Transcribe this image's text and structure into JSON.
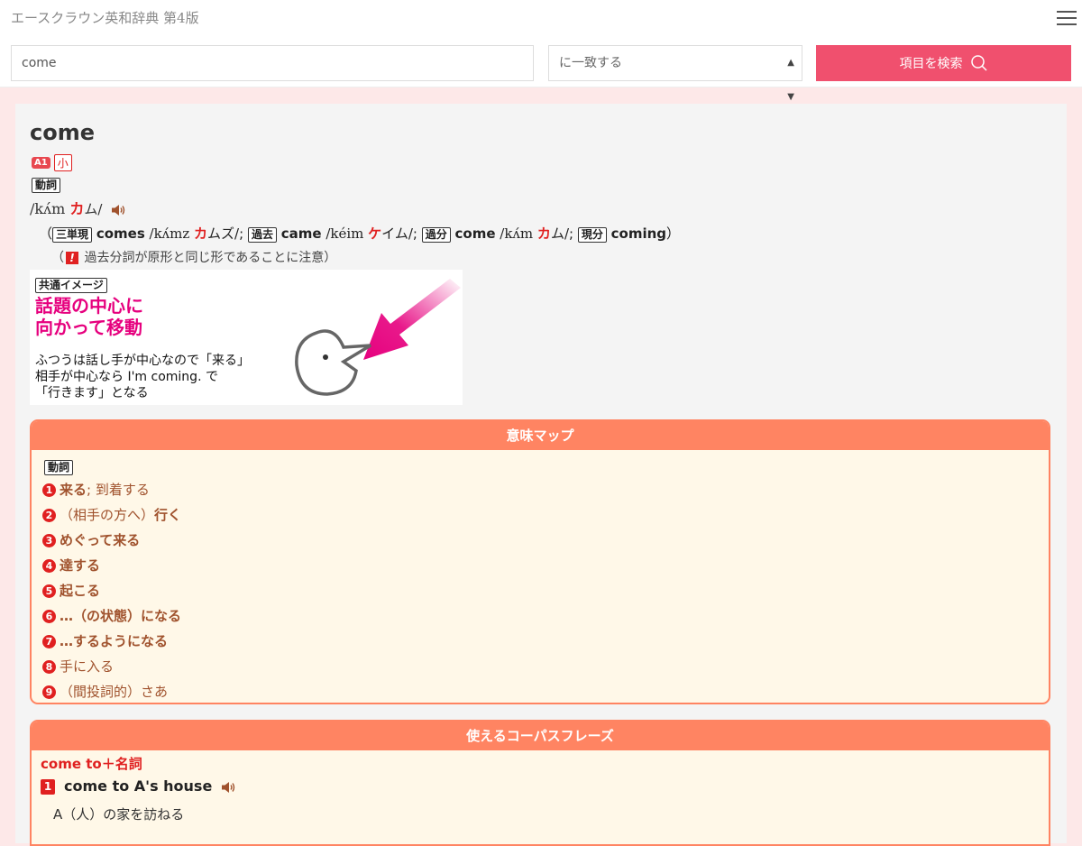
{
  "app": {
    "title": "エースクラウン英和辞典 第4版"
  },
  "search": {
    "query": "come",
    "match_mode": "に一致する",
    "button_label": "項目を検索"
  },
  "entry": {
    "headword": "come",
    "level_badge": "A1",
    "level_badge2": "小",
    "pos": "動詞",
    "pron_ipa": "/kʌ́m ",
    "pron_kana_red": "カ",
    "pron_kana_rest": "ム/",
    "inflections": {
      "open": "（",
      "t1": "三単現",
      "w1": "comes",
      "i1": " /kʌ́mz ",
      "r1": "カ",
      "k1": "ムズ/; ",
      "t2": "過去",
      "w2": "came",
      "i2": " /kéim ",
      "r2": "ケ",
      "k2": "イム/; ",
      "t3": "過分",
      "w3": "come",
      "i3": " /kʌ́m ",
      "r3": "カ",
      "k3": "ム/; ",
      "t4": "現分",
      "w4": "coming",
      "close": "）"
    },
    "note_open": "（",
    "note_icon": "!",
    "note_text": "過去分詞が原形と同じ形であることに注意）",
    "image": {
      "tag": "共通イメージ",
      "head1": "話題の中心に",
      "head2": "向かって移動",
      "line1": "ふつうは話し手が中心なので「来る」",
      "line2": "相手が中心なら I'm coming. で",
      "line3": "「行きます」となる"
    }
  },
  "meaning_map": {
    "title": "意味マップ",
    "pos": "動詞",
    "items": [
      {
        "num": "1",
        "bold": "来る",
        "rest": "; 到着する"
      },
      {
        "num": "2",
        "bold": "",
        "rest": "（相手の方へ）",
        "bold2": "行く"
      },
      {
        "num": "3",
        "bold": "めぐって来る",
        "rest": ""
      },
      {
        "num": "4",
        "bold": "達する",
        "rest": ""
      },
      {
        "num": "5",
        "bold": "起こる",
        "rest": ""
      },
      {
        "num": "6",
        "bold": "…（の状態）になる",
        "rest": ""
      },
      {
        "num": "7",
        "bold": "…するようになる",
        "rest": ""
      },
      {
        "num": "8",
        "bold": "",
        "rest": "手に入る"
      },
      {
        "num": "9",
        "bold": "",
        "rest": "（間投詞的）さあ"
      }
    ]
  },
  "corpus": {
    "title": "使えるコーパスフレーズ",
    "pattern": "come to＋名詞",
    "phrase_num": "1",
    "phrase": "come to A's house",
    "gloss": "A（人）の家を訪ねる"
  },
  "colors": {
    "accent": "#f0506e",
    "box": "#ff8462",
    "red": "#e02020",
    "magenta": "#e6007e"
  },
  "icons": {
    "menu": "hamburger-menu-icon",
    "search": "search-icon",
    "speaker": "speaker-icon"
  }
}
